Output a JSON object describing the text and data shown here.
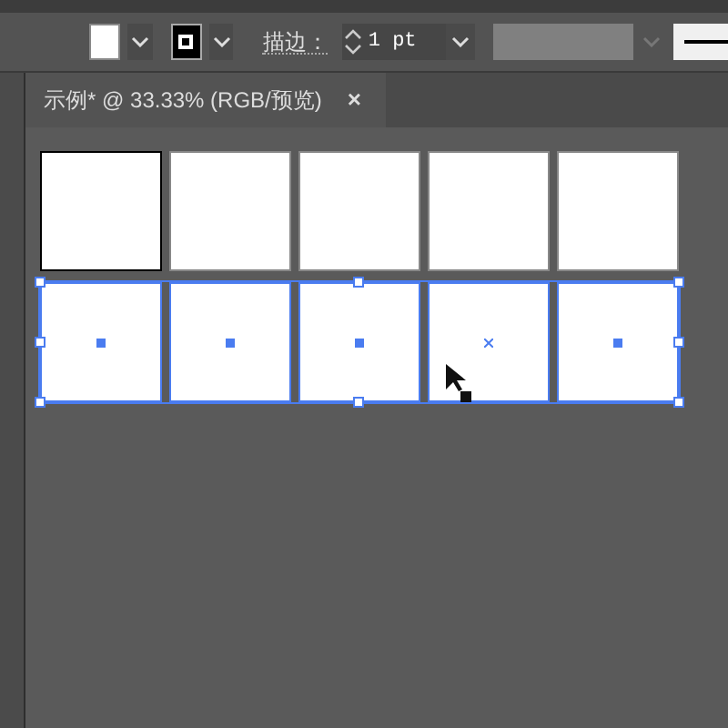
{
  "control_bar": {
    "stroke_label": "描边：",
    "stroke_weight": "1 pt"
  },
  "document_tab": {
    "title": "示例* @ 33.33% (RGB/预览)",
    "close": "×",
    "selected": true
  },
  "artboard_rows": [
    {
      "selected": false,
      "cells": [
        {
          "kind": "outlined"
        },
        {
          "kind": "plain"
        },
        {
          "kind": "plain"
        },
        {
          "kind": "plain"
        },
        {
          "kind": "plain"
        }
      ]
    },
    {
      "selected": true,
      "cells": [
        {
          "kind": "center-point"
        },
        {
          "kind": "center-point"
        },
        {
          "kind": "center-point"
        },
        {
          "kind": "center-cross"
        },
        {
          "kind": "center-point"
        }
      ]
    }
  ]
}
